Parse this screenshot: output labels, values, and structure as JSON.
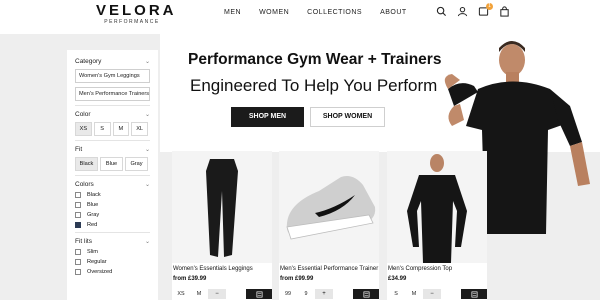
{
  "brand": {
    "name": "VELORA",
    "tagline": "PERFORMANCE"
  },
  "nav": [
    "MEN",
    "WOMEN",
    "COLLECTIONS",
    "ABOUT"
  ],
  "header_icons": [
    "search-icon",
    "user-icon",
    "wishlist-icon",
    "bag-icon"
  ],
  "wishlist_count": "1",
  "hero": {
    "title": "Performance Gym Wear + Trainers",
    "subtitle": "Engineered To Help You Perform",
    "btn_men": "SHOP MEN",
    "btn_women": "SHOP WOMEN"
  },
  "filters": {
    "category": {
      "label": "Category",
      "items": [
        "Women's Gym Leggings",
        "Men's Performance Trainers"
      ]
    },
    "color": {
      "label": "Color",
      "sizes": [
        "XS",
        "S",
        "M",
        "XL"
      ],
      "active": "XS"
    },
    "fit": {
      "label": "Fit",
      "items": [
        "Black",
        "Blue",
        "Gray"
      ],
      "active": "Black"
    },
    "colors": {
      "label": "Colors",
      "items": [
        "Black",
        "Blue",
        "Gray",
        "Red"
      ],
      "checked": "Red"
    },
    "fitlits": {
      "label": "Fit lits",
      "items": [
        "Slim",
        "Regular",
        "Oversized"
      ]
    }
  },
  "products": [
    {
      "name": "Women's Essentials Leggings",
      "price": "from £39.99",
      "opt1": "XS",
      "opt2": "M",
      "qty": "−"
    },
    {
      "name": "Men's Essential Performance Trainer",
      "price": "from £99.99",
      "opt1": "99",
      "opt2": "9",
      "qty": "+"
    },
    {
      "name": "Men's Compression Top",
      "price": "£34.99",
      "opt1": "S",
      "opt2": "M",
      "qty": "−"
    }
  ],
  "colors": {
    "dark": "#1b1b1b",
    "checked": "#2c3b54",
    "badge": "#f2a23a"
  }
}
